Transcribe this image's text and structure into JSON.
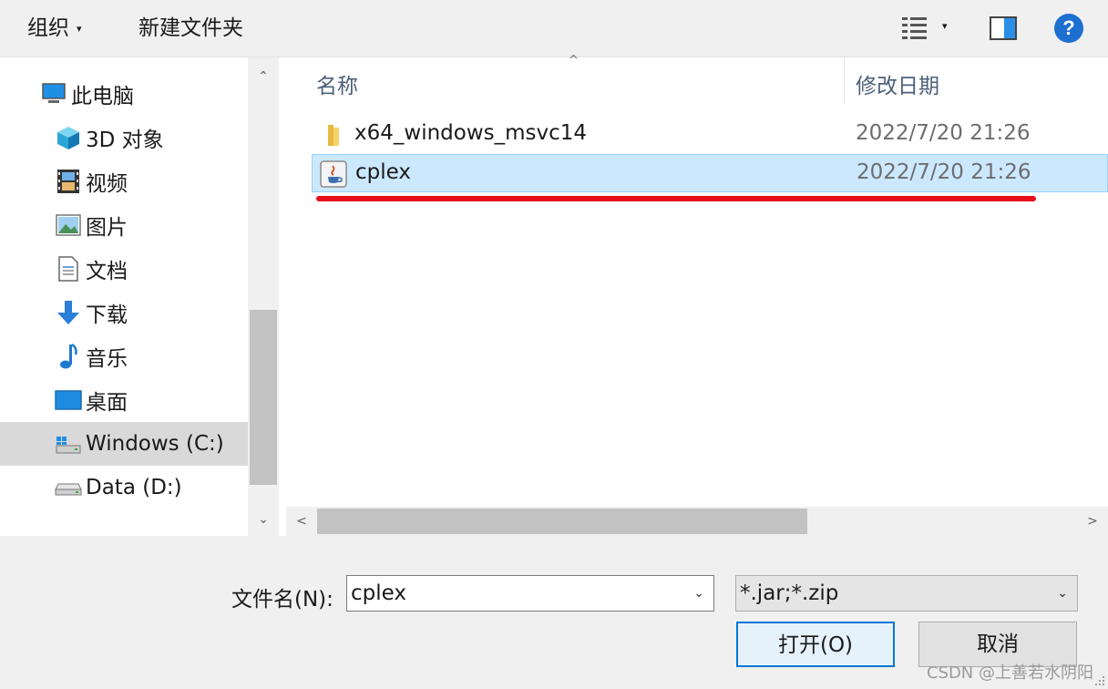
{
  "toolbar": {
    "organize_label": "组织",
    "organize_caret": "▾",
    "new_folder_label": "新建文件夹",
    "view_caret": "▾",
    "help_label": "?"
  },
  "nav": {
    "items": [
      {
        "label": "此电脑",
        "icon": "computer-icon"
      },
      {
        "label": "3D 对象",
        "icon": "cube-3d-icon"
      },
      {
        "label": "视频",
        "icon": "video-icon"
      },
      {
        "label": "图片",
        "icon": "picture-icon"
      },
      {
        "label": "文档",
        "icon": "document-icon"
      },
      {
        "label": "下载",
        "icon": "download-icon"
      },
      {
        "label": "音乐",
        "icon": "music-icon"
      },
      {
        "label": "桌面",
        "icon": "desktop-icon"
      },
      {
        "label": "Windows (C:)",
        "icon": "windows-drive-icon",
        "selected": true
      },
      {
        "label": "Data (D:)",
        "icon": "drive-icon"
      }
    ],
    "scroll_up": "⌃",
    "scroll_down": "⌄"
  },
  "files": {
    "columns": {
      "name": "名称",
      "date": "修改日期"
    },
    "sort_indicator": "^",
    "rows": [
      {
        "name": "x64_windows_msvc14",
        "date": "2022/7/20 21:26",
        "icon": "folder-icon"
      },
      {
        "name": "cplex",
        "date": "2022/7/20 21:26",
        "icon": "java-jar-icon",
        "selected": true
      }
    ],
    "hscroll_left": "<",
    "hscroll_right": ">"
  },
  "bottom": {
    "filename_label": "文件名(N):",
    "filename_value": "cplex",
    "filetype_value": "*.jar;*.zip",
    "dropdown_caret": "⌄",
    "open_label": "打开(O)",
    "cancel_label": "取消"
  },
  "watermark": "CSDN @上善若水阴阳",
  "colors": {
    "selection": "#cce8ff",
    "accent": "#0078d7",
    "annotation_red": "#e8101a"
  }
}
